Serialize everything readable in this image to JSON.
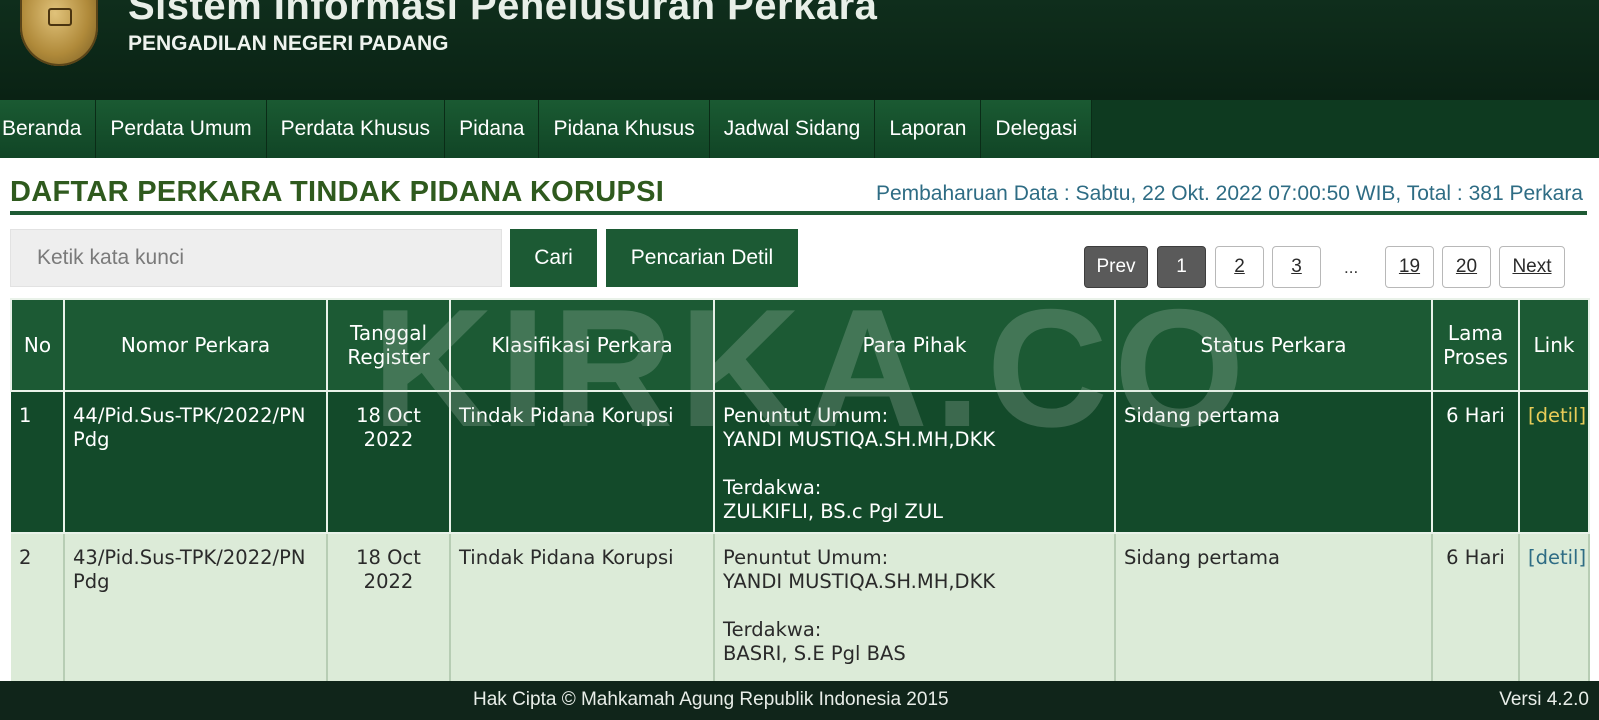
{
  "header": {
    "title": "Sistem Informasi Penelusuran Perkara",
    "subtitle": "PENGADILAN NEGERI PADANG"
  },
  "nav": {
    "items": [
      "Beranda",
      "Perdata Umum",
      "Perdata Khusus",
      "Pidana",
      "Pidana Khusus",
      "Jadwal Sidang",
      "Laporan",
      "Delegasi"
    ]
  },
  "page": {
    "title": "DAFTAR PERKARA TINDAK PIDANA KORUPSI",
    "update_info": "Pembaharuan Data : Sabtu, 22 Okt. 2022 07:00:50 WIB, Total : 381 Perkara"
  },
  "search": {
    "placeholder": "Ketik kata kunci",
    "value": "",
    "search_button": "Cari",
    "advanced_button": "Pencarian Detil"
  },
  "pagination": {
    "prev": "Prev",
    "current": "1",
    "pages_before": [
      "2",
      "3"
    ],
    "ellipsis": "...",
    "pages_after": [
      "19",
      "20"
    ],
    "next": "Next"
  },
  "table": {
    "headers": [
      "No",
      "Nomor Perkara",
      "Tanggal Register",
      "Klasifikasi Perkara",
      "Para Pihak",
      "Status Perkara",
      "Lama Proses",
      "Link"
    ],
    "rows": [
      {
        "no": "1",
        "nomor": "44/Pid.Sus-TPK/2022/PN Pdg",
        "tanggal": "18 Oct 2022",
        "klasifikasi": "Tindak Pidana Korupsi",
        "pihak_label_1": "Penuntut Umum:",
        "pihak_value_1": "YANDI MUSTIQA.SH.MH,DKK",
        "pihak_label_2": "Terdakwa:",
        "pihak_value_2": "ZULKIFLI, BS.c Pgl ZUL",
        "status": "Sidang pertama",
        "lama": "6 Hari",
        "link": "[detil]"
      },
      {
        "no": "2",
        "nomor": "43/Pid.Sus-TPK/2022/PN Pdg",
        "tanggal": "18 Oct 2022",
        "klasifikasi": "Tindak Pidana Korupsi",
        "pihak_label_1": "Penuntut Umum:",
        "pihak_value_1": "YANDI MUSTIQA.SH.MH,DKK",
        "pihak_label_2": "Terdakwa:",
        "pihak_value_2": "BASRI, S.E Pgl BAS",
        "status": "Sidang pertama",
        "lama": "6 Hari",
        "link": "[detil]"
      }
    ]
  },
  "footer": {
    "copyright": "Hak Cipta © Mahkamah Agung Republik Indonesia 2015",
    "version": "Versi 4.2.0"
  },
  "watermark": "KIRKA.CO",
  "colors": {
    "header_bg": "#0f2e1c",
    "nav_bg": "#1a5a32",
    "table_header": "#1c5a34",
    "row_dark": "#134a2a",
    "row_light": "#dcebd8",
    "accent_link": "#2e6c84",
    "title_green": "#2f5a1e"
  },
  "icons": {
    "logo": "court-emblem-icon"
  }
}
